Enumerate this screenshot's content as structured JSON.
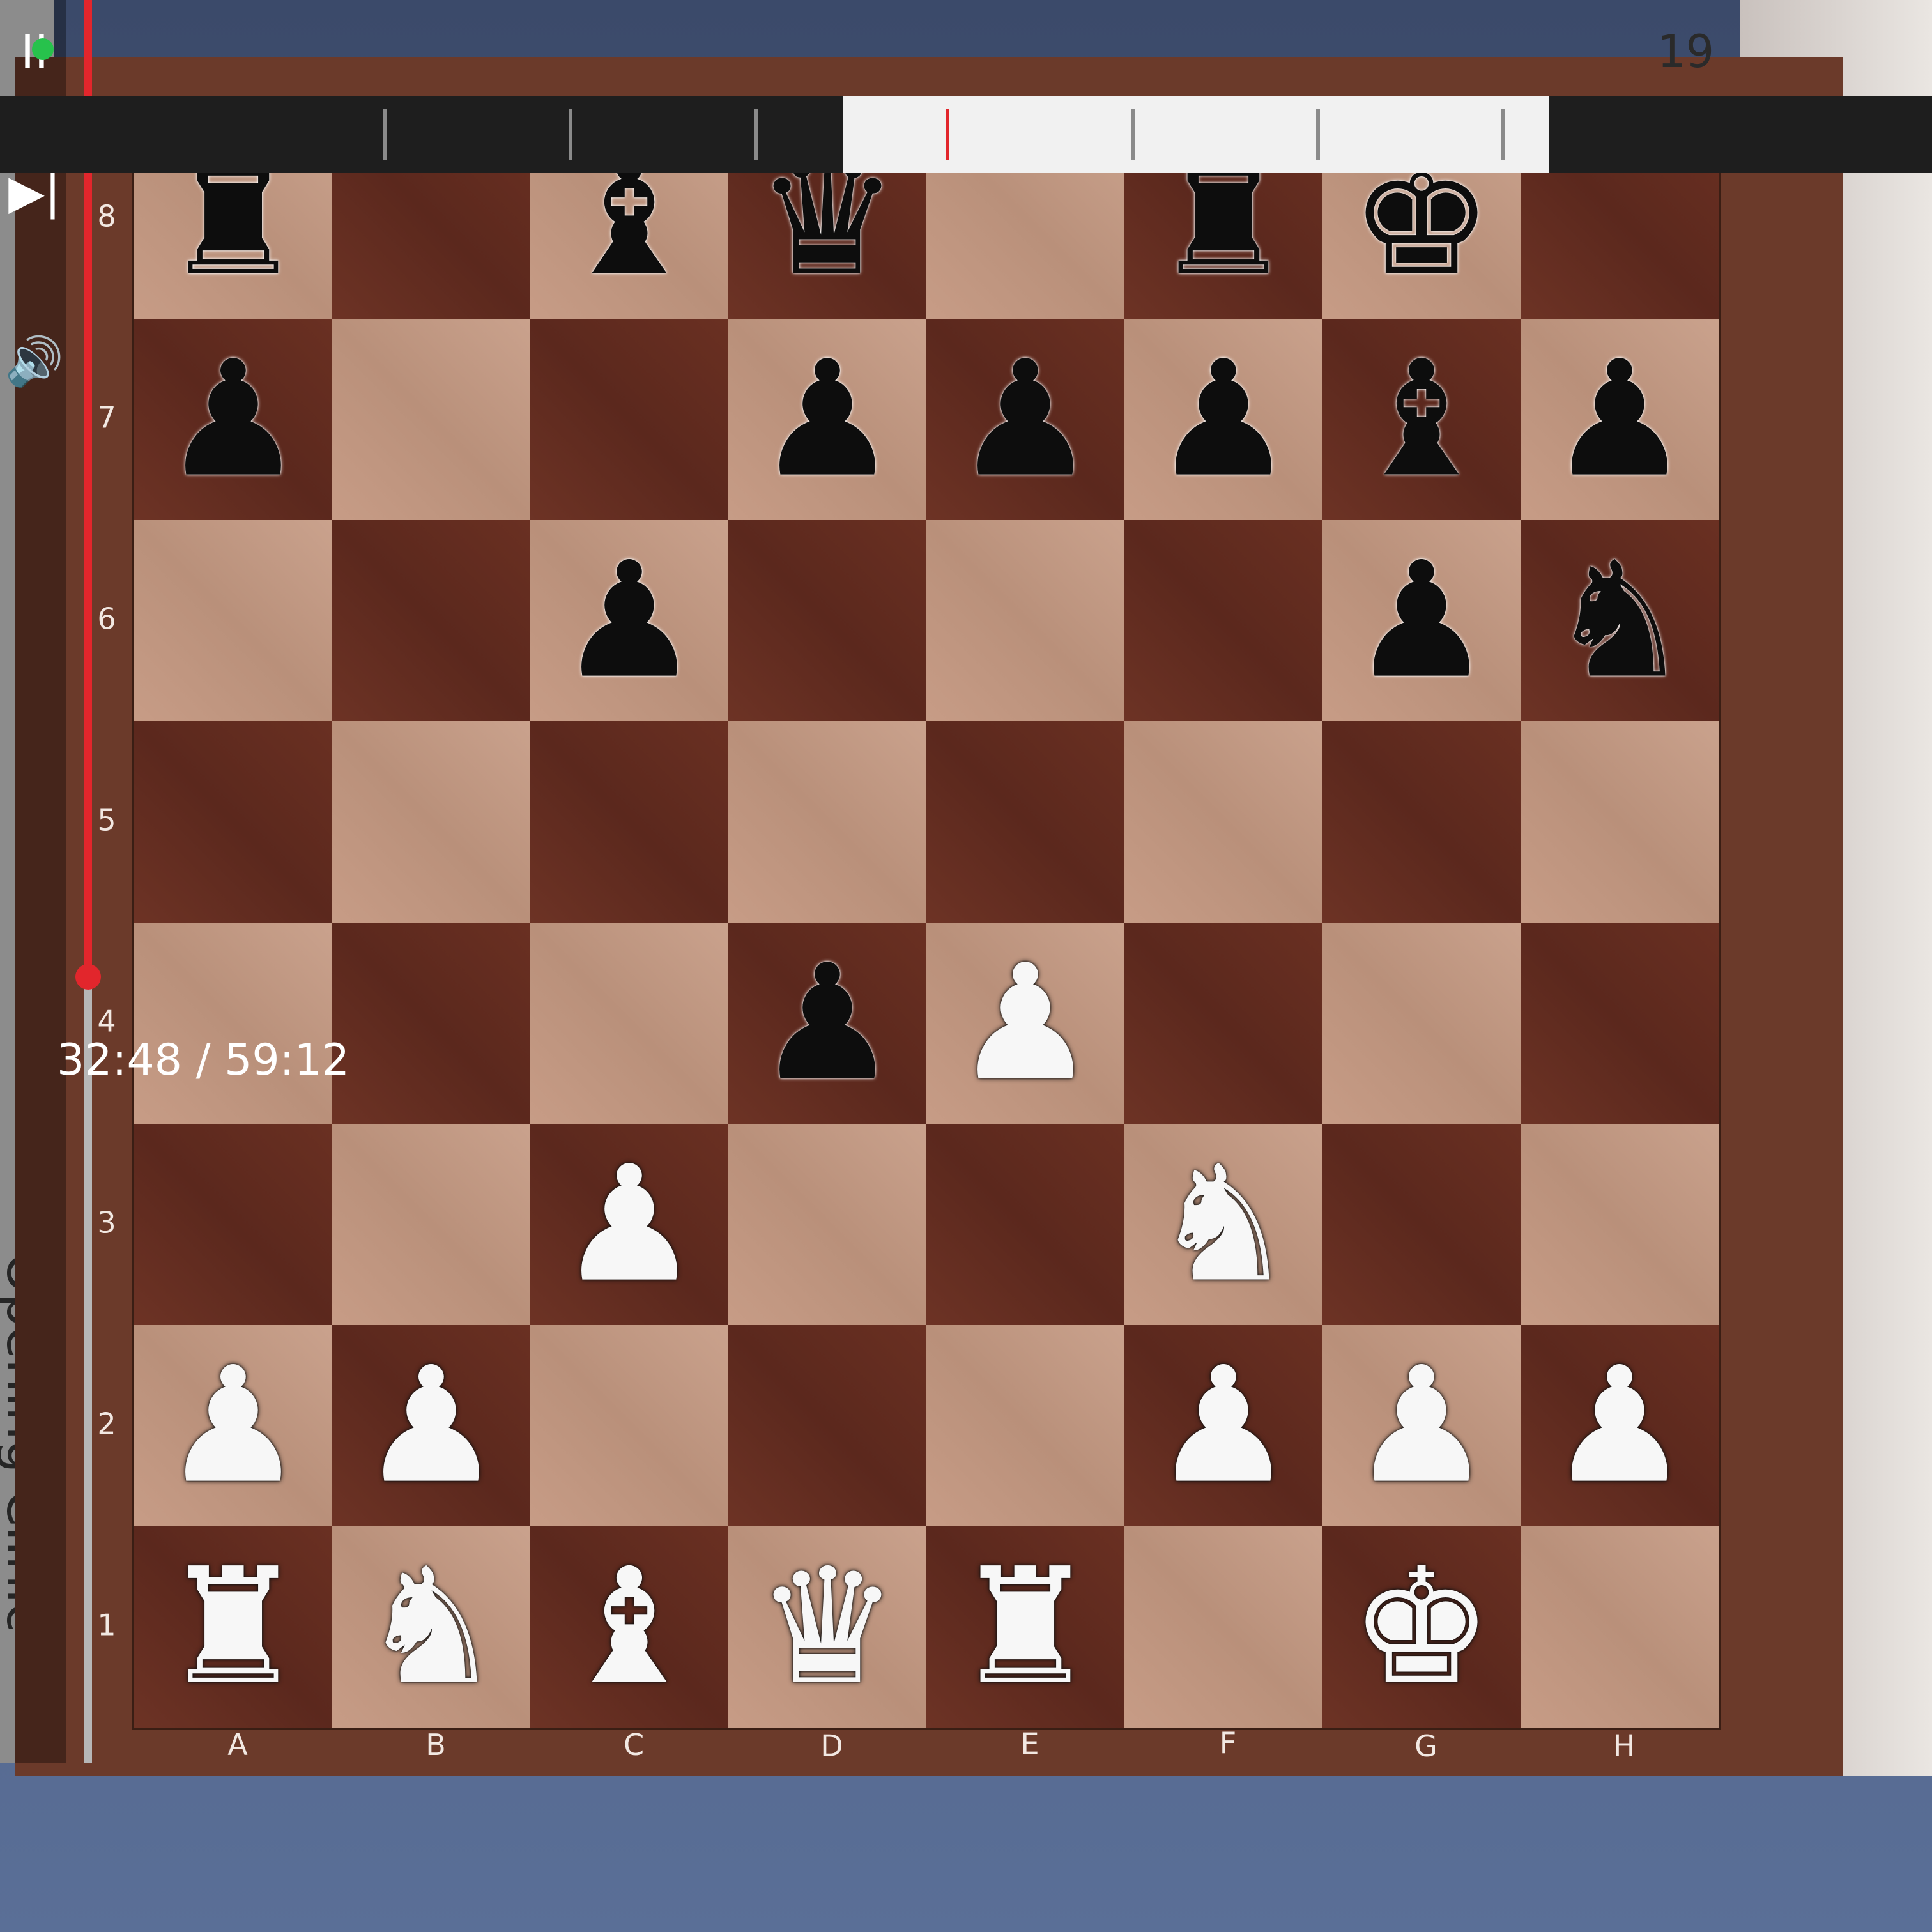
{
  "video": {
    "title": "Opening Clinic",
    "move_number": "19",
    "timecode": "32:48 / 59:12",
    "progress_fraction": 0.554
  },
  "controls": {
    "pause_icon": "pause-icon",
    "next_icon": "next-icon",
    "volume_icon": "volume-icon",
    "pause_label": "II",
    "next_label": "▶|",
    "volume_label": "🔊"
  },
  "board": {
    "files": [
      "A",
      "B",
      "C",
      "D",
      "E",
      "F",
      "G",
      "H"
    ],
    "ranks": [
      "8",
      "7",
      "6",
      "5",
      "4",
      "3",
      "2",
      "1"
    ],
    "pieces": [
      [
        "r",
        "",
        "b",
        "q",
        "",
        "r",
        "k",
        ""
      ],
      [
        "p",
        "",
        "",
        "p",
        "p",
        "p",
        "b",
        "p"
      ],
      [
        "",
        "",
        "p",
        "",
        "",
        "",
        "p",
        "n"
      ],
      [
        "",
        "",
        "",
        "",
        "",
        "",
        "",
        ""
      ],
      [
        "",
        "",
        "",
        "p",
        "P",
        "",
        "",
        ""
      ],
      [
        "",
        "",
        "P",
        "",
        "",
        "N",
        "",
        ""
      ],
      [
        "P",
        "P",
        "",
        "",
        "",
        "P",
        "P",
        "P"
      ],
      [
        "R",
        "N",
        "B",
        "Q",
        "R",
        "",
        "K",
        ""
      ]
    ]
  },
  "colors": {
    "accent_red": "#e2262c",
    "status_green": "#27c24c"
  }
}
